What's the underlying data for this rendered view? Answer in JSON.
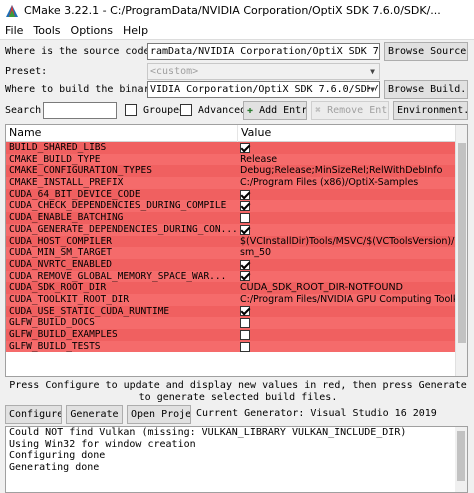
{
  "window": {
    "title": "CMake 3.22.1 - C:/ProgramData/NVIDIA Corporation/OptiX SDK 7.6.0/SDK/..."
  },
  "menu": [
    "File",
    "Tools",
    "Options",
    "Help"
  ],
  "source": {
    "label": "Where is the source code:",
    "value": "ramData/NVIDIA Corporation/OptiX SDK 7.6.0/SDK",
    "browse": "Browse Source..."
  },
  "preset": {
    "label": "Preset:",
    "value": "<custom>"
  },
  "build": {
    "label": "Where to build the binaries:",
    "value": "VIDIA Corporation/OptiX SDK 7.6.0/SDK/build",
    "browse": "Browse Build..."
  },
  "search": {
    "label": "Search:",
    "value": "",
    "grouped": "Grouped",
    "advanced": "Advanced",
    "add_entry": "Add Entry",
    "remove_entry": "Remove Entry",
    "environment": "Environment..."
  },
  "table": {
    "headers": [
      "Name",
      "Value"
    ],
    "rows": [
      {
        "name": "BUILD_SHARED_LIBS",
        "value": "",
        "checkbox": true,
        "checked": true
      },
      {
        "name": "CMAKE_BUILD_TYPE",
        "value": "Release",
        "checkbox": false,
        "checked": false
      },
      {
        "name": "CMAKE_CONFIGURATION_TYPES",
        "value": "Debug;Release;MinSizeRel;RelWithDebInfo",
        "checkbox": false,
        "checked": false
      },
      {
        "name": "CMAKE_INSTALL_PREFIX",
        "value": "C:/Program Files (x86)/OptiX-Samples",
        "checkbox": false,
        "checked": false
      },
      {
        "name": "CUDA_64_BIT_DEVICE_CODE",
        "value": "",
        "checkbox": true,
        "checked": true
      },
      {
        "name": "CUDA_CHECK_DEPENDENCIES_DURING_COMPILE",
        "value": "",
        "checkbox": true,
        "checked": true
      },
      {
        "name": "CUDA_ENABLE_BATCHING",
        "value": "",
        "checkbox": true,
        "checked": false
      },
      {
        "name": "CUDA_GENERATE_DEPENDENCIES_DURING_CON...",
        "value": "",
        "checkbox": true,
        "checked": true
      },
      {
        "name": "CUDA_HOST_COMPILER",
        "value": "$(VCInstallDir)Tools/MSVC/$(VCToolsVersion)/bi...",
        "checkbox": false,
        "checked": false
      },
      {
        "name": "CUDA_MIN_SM_TARGET",
        "value": "sm_50",
        "checkbox": false,
        "checked": false
      },
      {
        "name": "CUDA_NVRTC_ENABLED",
        "value": "",
        "checkbox": true,
        "checked": true
      },
      {
        "name": "CUDA_REMOVE_GLOBAL_MEMORY_SPACE_WAR...",
        "value": "",
        "checkbox": true,
        "checked": true
      },
      {
        "name": "CUDA_SDK_ROOT_DIR",
        "value": "CUDA_SDK_ROOT_DIR-NOTFOUND",
        "checkbox": false,
        "checked": false
      },
      {
        "name": "CUDA_TOOLKIT_ROOT_DIR",
        "value": "C:/Program Files/NVIDIA GPU Computing Toolkit",
        "checkbox": false,
        "checked": false
      },
      {
        "name": "CUDA_USE_STATIC_CUDA_RUNTIME",
        "value": "",
        "checkbox": true,
        "checked": true
      },
      {
        "name": "GLFW_BUILD_DOCS",
        "value": "",
        "checkbox": true,
        "checked": false
      },
      {
        "name": "GLFW_BUILD_EXAMPLES",
        "value": "",
        "checkbox": true,
        "checked": false
      },
      {
        "name": "GLFW_BUILD_TESTS",
        "value": "",
        "checkbox": true,
        "checked": false
      }
    ]
  },
  "info_text": "Press Configure to update and display new values in red, then press Generate to generate selected build files.",
  "actions": {
    "configure": "Configure",
    "generate": "Generate",
    "open_project": "Open Project",
    "current_generator": "Current Generator: Visual Studio 16 2019"
  },
  "output_lines": [
    "Could NOT find Vulkan (missing: VULKAN_LIBRARY VULKAN_INCLUDE_DIR)",
    "Using Win32 for window creation",
    "Configuring done",
    "Generating done"
  ],
  "colors": {
    "changed_row": "#f06060",
    "window_bg": "#f0f0f0",
    "add_entry_icon": "#2e7d32",
    "remove_entry_icon": "#c0c0c0"
  }
}
